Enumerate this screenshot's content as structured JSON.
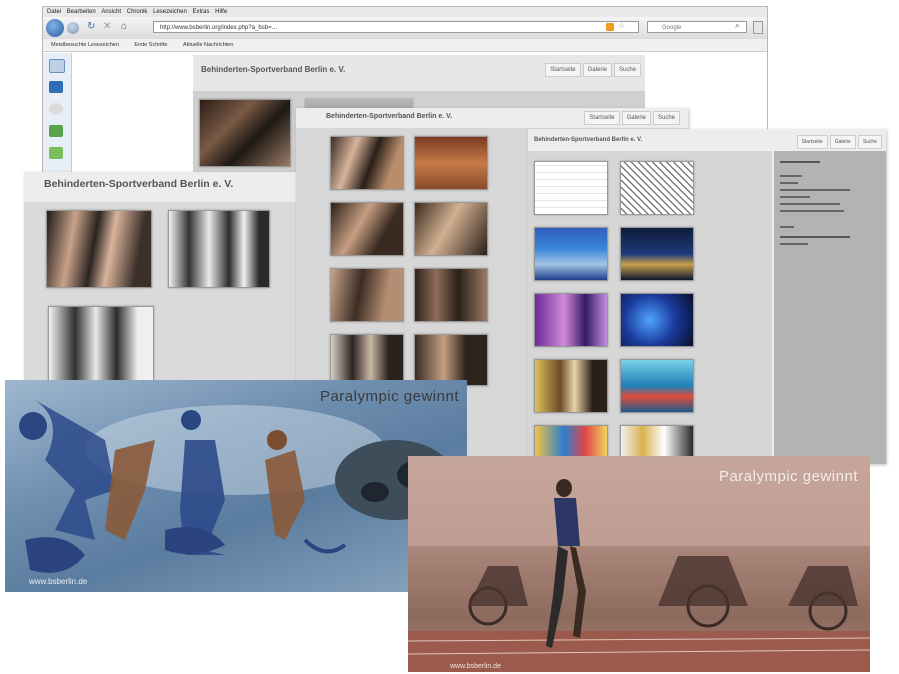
{
  "browser": {
    "menu": [
      "Datei",
      "Bearbeiten",
      "Ansicht",
      "Chronik",
      "Lesezeichen",
      "Extras",
      "Hilfe"
    ],
    "url": "http://www.bsberlin.org/index.php?a_bsb=…",
    "search_placeholder": "Google",
    "bookmarks": [
      "Meistbesuchte Lesezeichen",
      "Erste Schritte",
      "Aktuelle Nachrichten"
    ]
  },
  "site": {
    "title": "Behinderten-Sportverband Berlin e. V.",
    "nav": [
      "Startseite",
      "Galerie",
      "Suche"
    ]
  },
  "poster_left": {
    "headline": "Paralympic gewinnt",
    "footer": "www.bsberlin.de"
  },
  "poster_right": {
    "headline": "Paralympic gewinnt",
    "footer": "www.bsberlin.de"
  },
  "colors": {
    "page_bg": "#ededed",
    "swim_poster": "#6c8fb3",
    "track_poster": "#b08a7c",
    "accent_red": "#b22"
  },
  "icons": [
    "back-arrow-icon",
    "forward-arrow-icon",
    "reload-icon",
    "home-icon",
    "star-icon",
    "search-icon",
    "image-icon"
  ]
}
